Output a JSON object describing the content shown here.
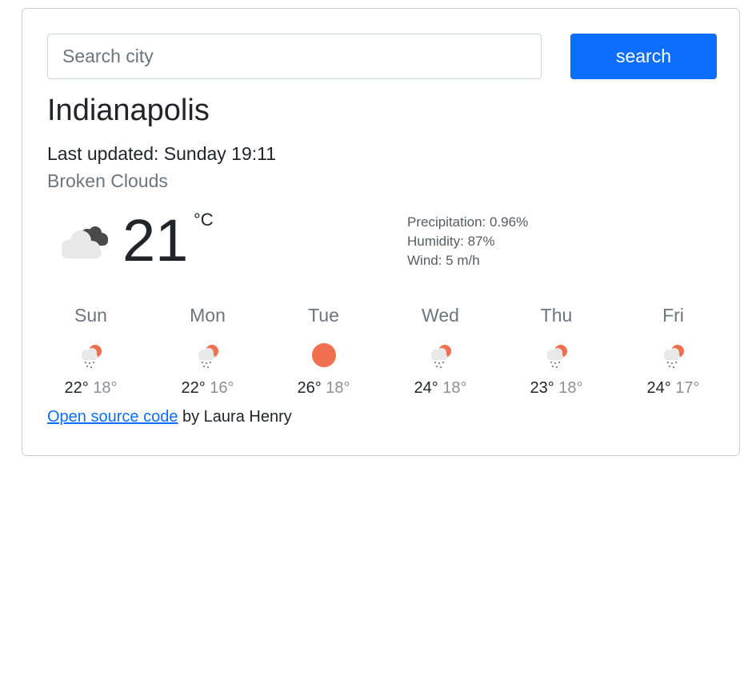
{
  "search": {
    "placeholder": "Search city",
    "value": "",
    "button_label": "search"
  },
  "current": {
    "city": "Indianapolis",
    "last_updated": "Last updated: Sunday 19:11",
    "description": "Broken Clouds",
    "temperature": "21",
    "unit": "°C",
    "icon": "broken-clouds-icon",
    "details": {
      "precipitation": "Precipitation: 0.96%",
      "humidity": "Humidity: 87%",
      "wind": "Wind: 5 m/h"
    }
  },
  "forecast": [
    {
      "day": "Sun",
      "max": "22°",
      "min": "18°",
      "icon": "rain-sun-icon"
    },
    {
      "day": "Mon",
      "max": "22°",
      "min": "16°",
      "icon": "rain-sun-icon"
    },
    {
      "day": "Tue",
      "max": "26°",
      "min": "18°",
      "icon": "sun-icon"
    },
    {
      "day": "Wed",
      "max": "24°",
      "min": "18°",
      "icon": "rain-sun-icon"
    },
    {
      "day": "Thu",
      "max": "23°",
      "min": "18°",
      "icon": "rain-sun-icon"
    },
    {
      "day": "Fri",
      "max": "24°",
      "min": "17°",
      "icon": "rain-sun-icon"
    }
  ],
  "footer": {
    "link_text": "Open source code",
    "suffix": " by Laura Henry"
  },
  "colors": {
    "accent": "#0d6efd",
    "sun": "#ef6f4f",
    "cloud_light": "#e6e6e6",
    "cloud_dark": "#4a4a4a"
  }
}
